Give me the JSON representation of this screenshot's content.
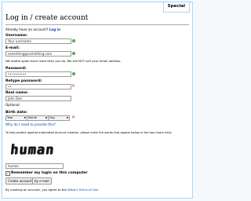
{
  "tab": {
    "label": "Special"
  },
  "header": {
    "title": "Log in / create account"
  },
  "account": {
    "prefix": "Already have an account?",
    "login_link": "Log in"
  },
  "username": {
    "label": "Username:",
    "value": "Your username"
  },
  "email": {
    "label": "E-mail:",
    "value": "something@something.com",
    "note": "We loathe spam even more than you do. We will NOT sell your email address."
  },
  "password": {
    "label": "Password:",
    "value": "••••••••••"
  },
  "retype": {
    "label": "Retype password:",
    "value": "••"
  },
  "realname": {
    "label": "Real name:",
    "value": "John Doe",
    "optional": "Optional"
  },
  "birthdate": {
    "label": "Birth date:",
    "year": "Year",
    "month": "Month",
    "day": "Day",
    "why_link": "Why do I need to provide this?"
  },
  "captcha": {
    "instructions": "To help protect against automated account creation, please enter the words that appear below in the box (more info):",
    "image_word": "human",
    "answer": "human"
  },
  "remember": {
    "label": "Remember my login on this computer"
  },
  "buttons": {
    "create": "Create account",
    "by_email": "by e-mail"
  },
  "terms": {
    "prefix": "By creating an account, you agree to the",
    "link": "Wikia's Terms of Use."
  },
  "colors": {
    "link": "#0645ad",
    "valid": "#3aa43a",
    "invalid": "#dd3333",
    "border": "#a7d7f9"
  },
  "icons": {
    "valid": "check-circle-icon",
    "invalid": "x-mark-icon"
  }
}
